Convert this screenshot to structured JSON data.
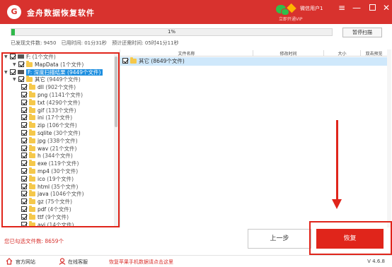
{
  "app": {
    "title": "金舟数据恢复软件",
    "logo_char": "G",
    "user_label": "微信用户1",
    "user_sub": "立即开通VIP"
  },
  "titlebar": {
    "menu": "≡",
    "minimize": "—",
    "close": "✕"
  },
  "progress": {
    "value": 0.01,
    "label": "1%",
    "pause_label": "暂停扫描"
  },
  "stats": {
    "found": "已发现文件数: 9450",
    "elapsed": "已用时间: 01分31秒",
    "remaining": "预计还需时间: 05时41分11秒"
  },
  "tree": [
    {
      "label": "F:",
      "count": "(1个文件)",
      "level": 0,
      "type": "drive",
      "check": "checked"
    },
    {
      "label": "MapData",
      "count": "(1个文件)",
      "level": 1,
      "type": "folder",
      "check": "checked"
    },
    {
      "label": "F: 深度扫描结果",
      "count": "(9449个文件)",
      "level": 0,
      "type": "drive",
      "check": "checked",
      "highlight": true
    },
    {
      "label": "其它",
      "count": "(9449个文件)",
      "level": 1,
      "type": "folder",
      "check": "checked"
    },
    {
      "label": "dll",
      "count": "(902个文件)",
      "level": 2,
      "type": "folder",
      "check": "checked"
    },
    {
      "label": "png",
      "count": "(1141个文件)",
      "level": 2,
      "type": "folder",
      "check": "checked"
    },
    {
      "label": "txt",
      "count": "(4290个文件)",
      "level": 2,
      "type": "folder",
      "check": "checked"
    },
    {
      "label": "gif",
      "count": "(133个文件)",
      "level": 2,
      "type": "folder",
      "check": "checked"
    },
    {
      "label": "ini",
      "count": "(17个文件)",
      "level": 2,
      "type": "folder",
      "check": "checked"
    },
    {
      "label": "zip",
      "count": "(106个文件)",
      "level": 2,
      "type": "folder",
      "check": "checked"
    },
    {
      "label": "sqlite",
      "count": "(30个文件)",
      "level": 2,
      "type": "folder",
      "check": "checked"
    },
    {
      "label": "jpg",
      "count": "(338个文件)",
      "level": 2,
      "type": "folder",
      "check": "checked"
    },
    {
      "label": "wav",
      "count": "(21个文件)",
      "level": 2,
      "type": "folder",
      "check": "checked"
    },
    {
      "label": "h",
      "count": "(344个文件)",
      "level": 2,
      "type": "folder",
      "check": "checked"
    },
    {
      "label": "exe",
      "count": "(119个文件)",
      "level": 2,
      "type": "folder",
      "check": "checked"
    },
    {
      "label": "mp4",
      "count": "(30个文件)",
      "level": 2,
      "type": "folder",
      "check": "checked"
    },
    {
      "label": "ico",
      "count": "(19个文件)",
      "level": 2,
      "type": "folder",
      "check": "checked"
    },
    {
      "label": "html",
      "count": "(35个文件)",
      "level": 2,
      "type": "folder",
      "check": "checked"
    },
    {
      "label": "java",
      "count": "(1046个文件)",
      "level": 2,
      "type": "folder",
      "check": "checked"
    },
    {
      "label": "gz",
      "count": "(75个文件)",
      "level": 2,
      "type": "folder",
      "check": "checked"
    },
    {
      "label": "pdf",
      "count": "(4个文件)",
      "level": 2,
      "type": "folder",
      "check": "checked"
    },
    {
      "label": "ttf",
      "count": "(9个文件)",
      "level": 2,
      "type": "folder",
      "check": "checked"
    },
    {
      "label": "avi",
      "count": "(14个文件)",
      "level": 2,
      "type": "folder",
      "check": "checked"
    }
  ],
  "file_list": {
    "columns": [
      "文件名称",
      "修改时间",
      "大小",
      "双击预览"
    ],
    "rows": [
      {
        "name": "其它",
        "count": "(8649个文件)",
        "check": "checked"
      }
    ]
  },
  "bottom": {
    "selected": "您已勾选文件数: 8659个",
    "prev_label": "上一步",
    "recover_label": "恢复"
  },
  "footer": {
    "site": "官方网站",
    "service": "在线客服",
    "promo": "恢复苹果手机数据请点击这里",
    "version": "V 4.6.8"
  },
  "colors": {
    "brand": "#d8322e",
    "progress": "#2fb94a",
    "highlight": "#1e8fe0",
    "annotation": "#e0251b"
  }
}
